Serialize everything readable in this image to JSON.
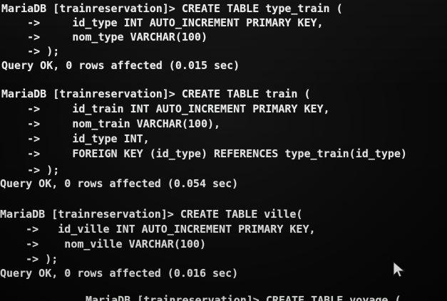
{
  "terminal": {
    "lines": [
      "MariaDB [trainreservation]> CREATE TABLE type_train (",
      "    ->     id_type INT AUTO_INCREMENT PRIMARY KEY,",
      "    ->     nom_type VARCHAR(100)",
      "    -> );",
      "Query OK, 0 rows affected (0.015 sec)",
      "",
      "MariaDB [trainreservation]> CREATE TABLE train (",
      "    ->     id_train INT AUTO_INCREMENT PRIMARY KEY,",
      "    ->     nom_train VARCHAR(100),",
      "    ->     id_type INT,",
      "    ->     FOREIGN KEY (id_type) REFERENCES type_train(id_type)",
      "    -> );",
      "Query OK, 0 rows affected (0.054 sec)",
      "",
      "MariaDB [trainreservation]> CREATE TABLE ville(",
      "    ->   id_ville INT AUTO_INCREMENT PRIMARY KEY,",
      "    ->    nom_ville VARCHAR(100)",
      "    -> );",
      "Query OK, 0 rows affected (0.016 sec)",
      "",
      "MariaDB [trainreservation]> CREATE TABLE voyage ("
    ]
  },
  "icons": {
    "cursor": "mouse-pointer-icon"
  }
}
